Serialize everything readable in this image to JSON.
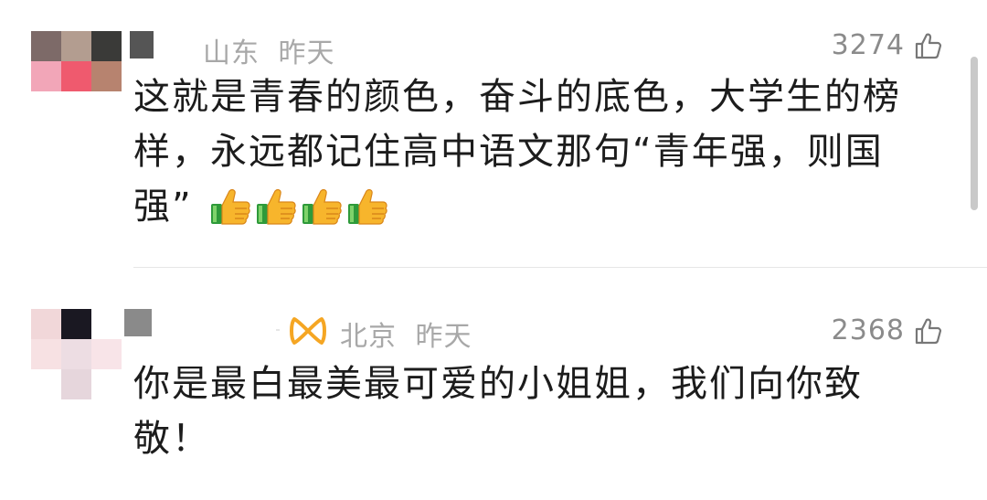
{
  "comments": [
    {
      "location": "山东",
      "time": "昨天",
      "likes": "3274",
      "text": "这就是青春的颜色，奋斗的底色，大学生的榜样，永远都记住高中语文那句“青年强，则国强”",
      "emojis": [
        "thumbs-up",
        "thumbs-up",
        "thumbs-up",
        "thumbs-up"
      ],
      "avatar_colors": [
        "#7d6a68",
        "#b39d90",
        "#3a3a38",
        "#f2a6b8",
        "#ef5a6e",
        "#b7836f",
        "#ffffff",
        "#ffffff",
        "#ffffff"
      ]
    },
    {
      "location": "北京",
      "time": "昨天",
      "likes": "2368",
      "text": "你是最白最美最可爱的小姐姐，我们向你致敬！",
      "badge_icon": "orange-ribbon-icon",
      "avatar_colors": [
        "#f1d7d9",
        "#1a1822",
        "#ffffff",
        "#f7e1e3",
        "#eddde3",
        "#f8e4e8",
        "#ffffff",
        "#e6d6dc",
        "#ffffff"
      ]
    }
  ],
  "colors": {
    "meta_text": "#a8a8a8",
    "like_text": "#8b8b8b",
    "body_text": "#1c1c1c",
    "badge_orange": "#f5a623"
  }
}
